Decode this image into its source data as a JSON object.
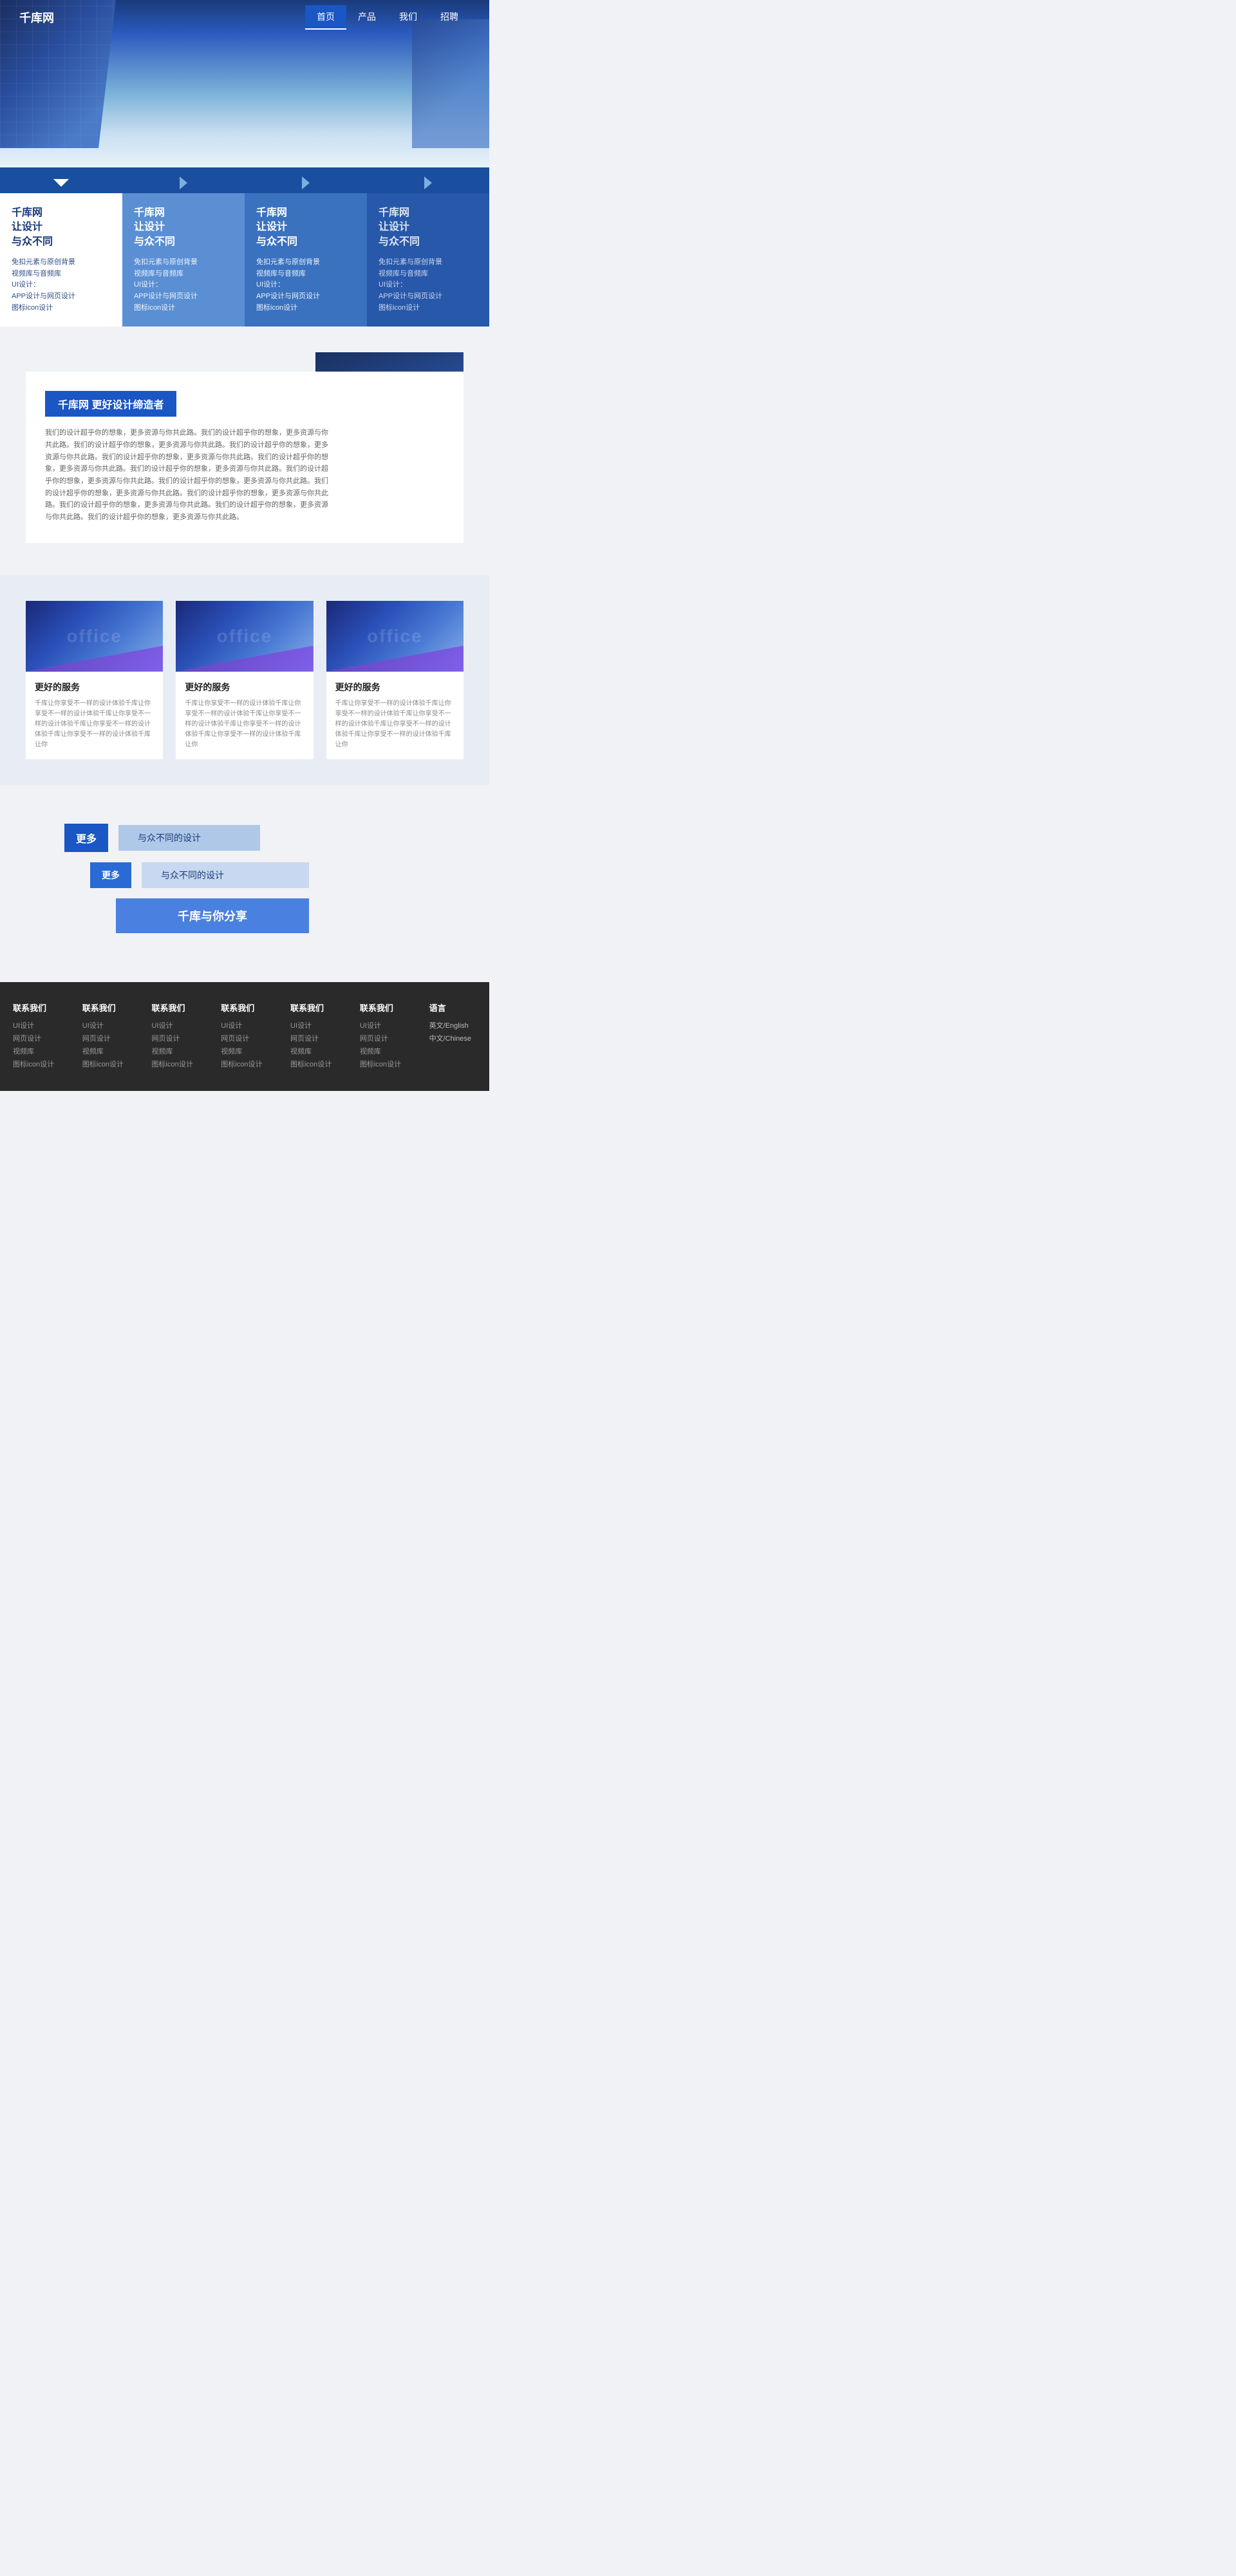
{
  "nav": {
    "logo": "千库网",
    "items": [
      {
        "label": "首页",
        "active": true
      },
      {
        "label": "产品",
        "active": false
      },
      {
        "label": "我们",
        "active": false
      },
      {
        "label": "招聘",
        "active": false
      }
    ]
  },
  "features": {
    "cards": [
      {
        "title": "千库网\n让设计\n与众不同",
        "desc": "免扣元素与原创背景\n视频库与音频库\nUI设计：\nAPP设计与网页设计\n图标icon设计"
      },
      {
        "title": "千库网\n让设计\n与众不同",
        "desc": "免扣元素与原创背景\n视频库与音频库\nUI设计：\nAPP设计与网页设计\n图标icon设计"
      },
      {
        "title": "千库网\n让设计\n与众不同",
        "desc": "免扣元素与原创背景\n视频库与音频库\nUI设计：\nAPP设计与网页设计\n图标icon设计"
      },
      {
        "title": "千库网\n让设计\n与众不同",
        "desc": "免扣元素与原创背景\n视频库与音频库\nUI设计：\nAPP设计与网页设计\n图标icon设计"
      }
    ]
  },
  "about": {
    "title": "千库网  更好设计缔造者",
    "text": "我们的设计超乎你的想象，更多资源与你共此路。我们的设计超乎你的想象，更多资源与你共此路。我们的设计超乎你的想象，更多资源与你共此路。我们的设计超乎你的想象，更多资源与你共此路。我们的设计超乎你的想象，更多资源与你共此路。我们的设计超乎你的想象，更多资源与你共此路。我们的设计超乎你的想象，更多资源与你共此路。我们的设计超乎你的想象，更多资源与你共此路。我们的设计超乎你的想象，更多资源与你共此路。我们的设计超乎你的想象，更多资源与你共此路。我们的设计超乎你的想象，更多资源与你共此路。我们的设计超乎你的想象，更多资源与你共此路。我们的设计超乎你的想象，更多资源与你共此路。我们的设计超乎你的想象，更多资源与你共此路。"
  },
  "services": {
    "cards": [
      {
        "office_text": "office",
        "title": "更好的服务",
        "desc": "千库让你享受不一样的设计体验千库让你享受不一样的设计体验千库让你享受不一样的设计体验千库让你享受不一样的设计体验千库让你享受不一样的设计体验千库让你"
      },
      {
        "office_text": "office",
        "title": "更好的服务",
        "desc": "千库让你享受不一样的设计体验千库让你享受不一样的设计体验千库让你享受不一样的设计体验千库让你享受不一样的设计体验千库让你享受不一样的设计体验千库让你"
      },
      {
        "office_text": "office",
        "title": "更好的服务",
        "desc": "千库让你享受不一样的设计体验千库让你享受不一样的设计体验千库让你享受不一样的设计体验千库让你享受不一样的设计体验千库让你享受不一样的设计体验千库让你"
      }
    ]
  },
  "cta": {
    "rows": [
      {
        "badge": "更多",
        "text": "与众不同的设计"
      },
      {
        "badge": "更多",
        "text": "与众不同的设计"
      },
      {
        "badge": null,
        "text": "千库与你分享"
      }
    ]
  },
  "footer": {
    "columns": [
      {
        "title": "联系我们",
        "links": [
          "UI设计",
          "网页设计",
          "视频库",
          "图标icon设计"
        ]
      },
      {
        "title": "联系我们",
        "links": [
          "UI设计",
          "网页设计",
          "视频库",
          "图标icon设计"
        ]
      },
      {
        "title": "联系我们",
        "links": [
          "UI设计",
          "网页设计",
          "视频库",
          "图标icon设计"
        ]
      },
      {
        "title": "联系我们",
        "links": [
          "UI设计",
          "网页设计",
          "视频库",
          "图标icon设计"
        ]
      },
      {
        "title": "联系我们",
        "links": [
          "UI设计",
          "网页设计",
          "视频库",
          "图标icon设计"
        ]
      },
      {
        "title": "联系我们",
        "links": [
          "UI设计",
          "网页设计",
          "视频库",
          "图标icon设计"
        ]
      },
      {
        "title": "语言",
        "links": [
          "英文/English",
          "中文/Chinese"
        ]
      }
    ]
  }
}
